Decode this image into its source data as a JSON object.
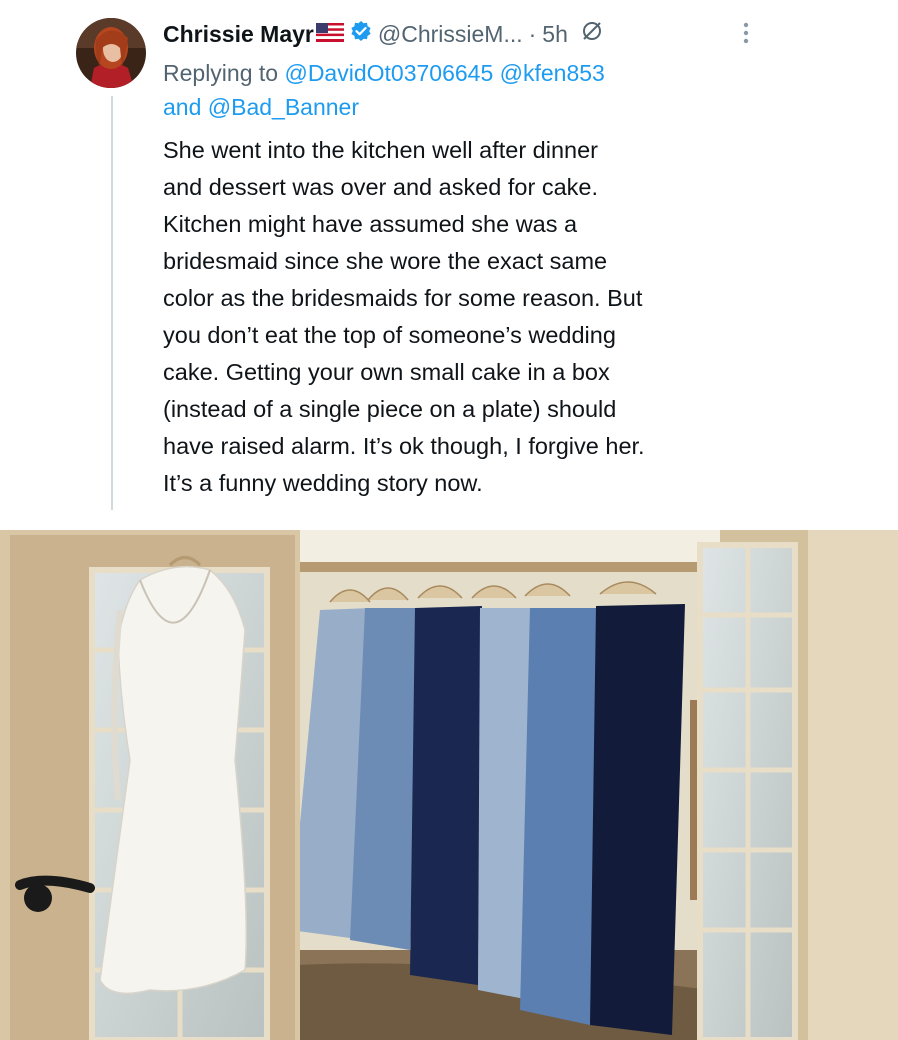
{
  "tweet": {
    "author_name": "Chrissie Mayr",
    "handle": "@ChrissieM...",
    "separator": "·",
    "time": "5h",
    "reply_prefix": "Replying to",
    "mention_1": "@DavidOt03706645",
    "mention_2": "@kfen853",
    "conjunction": "and",
    "mention_3": "@Bad_Banner",
    "body_lines": [
      "She went into the kitchen well after dinner",
      "and dessert was over and asked for cake.",
      "Kitchen might have assumed she was a",
      "bridesmaid since she wore the exact same",
      "color as the bridesmaids for some reason. But",
      "you don’t eat the top of someone’s wedding",
      "cake. Getting your own small cake in a box",
      "(instead of a single piece on a plate) should",
      "have raised alarm. It’s ok though, I forgive her.",
      "It’s a funny wedding story now."
    ],
    "icons": {
      "flag": "us-flag-icon",
      "verified": "verified-badge-icon",
      "status": "slashed-circle-icon",
      "more": "more-options-icon"
    },
    "colors": {
      "text": "#0f1419",
      "secondary": "#536471",
      "link": "#1d9bf0"
    }
  }
}
